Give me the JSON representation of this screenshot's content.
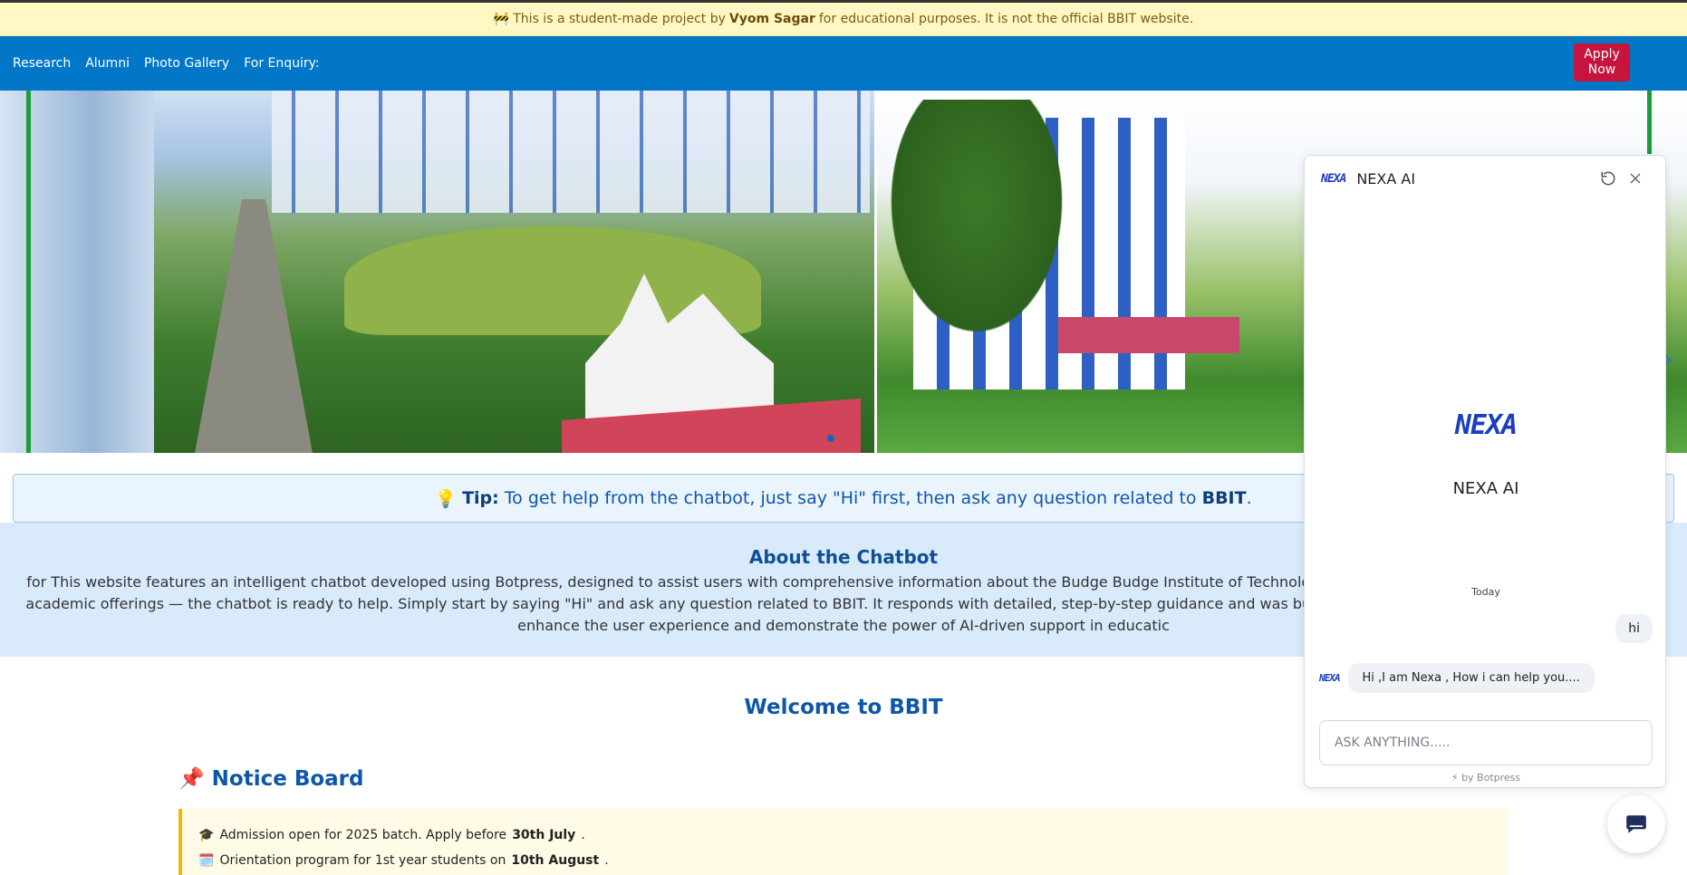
{
  "banner": {
    "icon": "🚧",
    "prefix": "This is a student-made project by",
    "author": "Vyom Sagar",
    "suffix": "for educational purposes. It is not the official BBIT website."
  },
  "nav": {
    "links": [
      "Research",
      "Alumni",
      "Photo Gallery",
      "For Enquiry:"
    ],
    "apply_label": "Apply\nNow"
  },
  "tip": {
    "icon": "💡",
    "label": "Tip:",
    "text_before": "To get help from the chatbot, just say \"Hi\" first, then ask any question related to",
    "highlight": "BBIT",
    "end": "."
  },
  "about": {
    "title": "About the Chatbot",
    "text": "for This website features an intelligent chatbot developed using Botpress, designed to assist users with comprehensive information about the Budge Budge Institute of Technology (BBIT). Whether criteria, faculty members, or academic offerings — the chatbot is ready to help. Simply start by saying \"Hi\" and ask any question related to BBIT. It responds with detailed, step-by-step guidance and was built as part of a student project by Vyom Sagar to enhance the user experience and demonstrate the power of AI-driven support in educatic"
  },
  "welcome": "Welcome to BBIT",
  "notice": {
    "icon": "📌",
    "title": "Notice Board",
    "items": [
      {
        "icon": "🎓",
        "text": "Admission open for 2025 batch. Apply before",
        "bold": "30th July",
        "end": "."
      },
      {
        "icon": "🗓️",
        "text": "Orientation program for 1st year students on",
        "bold": "10th August",
        "end": "."
      }
    ]
  },
  "chatbot": {
    "logo_text": "NEXA",
    "title": "NEXA AI",
    "center_name": "NEXA AI",
    "today": "Today",
    "user_message": "hi",
    "bot_message": "Hi ,I am Nexa , How i can help you....",
    "input_placeholder": "ASK ANYTHING.....",
    "footer": "⚡ by Botpress",
    "brand_color": "#1b3fbf"
  },
  "colors": {
    "navbar": "#0277c8",
    "apply": "#c6143c",
    "banner_bg": "#fff8c4",
    "tip_bg": "#eaf4fd",
    "about_bg": "#d9ebfb",
    "heading": "#0e57a8"
  }
}
